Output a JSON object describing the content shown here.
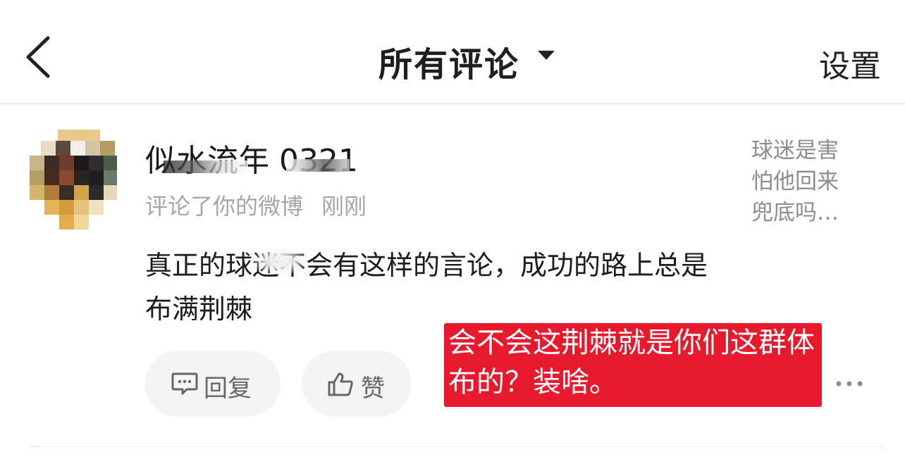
{
  "header": {
    "title": "所有评论",
    "settings_label": "设置"
  },
  "comment": {
    "username": "似水流年 0321",
    "meta_action": "评论了你的微博",
    "time": "刚刚",
    "body": "真正的球迷不会有这样的言论，成功的路上总是布满荆棘",
    "post_preview": "球迷是害怕他回来兜底吗…",
    "reply_label": "回复",
    "like_label": "赞"
  },
  "overlay_annotation": {
    "text": "会不会这荆棘就是你们这群体布的？装啥。",
    "background_color": "#e8192c"
  },
  "icons": [
    "back-icon",
    "dropdown-caret-icon",
    "comment-bubble-icon",
    "thumbs-up-icon",
    "more-icon"
  ]
}
